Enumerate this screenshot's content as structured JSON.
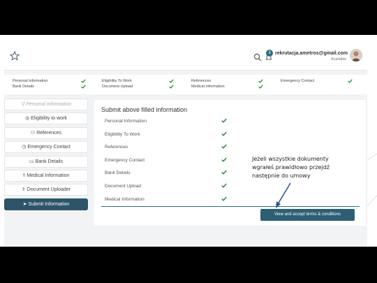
{
  "topbar": {
    "email": "rekrutacja.ametros@gmail.com",
    "status": "Available",
    "notification_count": "3"
  },
  "summary": [
    {
      "label": "Personal information",
      "done": true
    },
    {
      "label": "Bank Details",
      "done": true
    },
    {
      "label": "Eligibility To Work",
      "done": true
    },
    {
      "label": "Document Upload",
      "done": true
    },
    {
      "label": "References",
      "done": true
    },
    {
      "label": "Medical information",
      "done": true
    },
    {
      "label": "Emergency Contact",
      "done": true
    }
  ],
  "nav": [
    {
      "label": "Personal Information",
      "icon": "user-icon",
      "glyph": "⚲"
    },
    {
      "label": "Eligibility to work",
      "icon": "globe-icon",
      "glyph": "◎"
    },
    {
      "label": "References",
      "icon": "users-icon",
      "glyph": "⚇"
    },
    {
      "label": "Emergency Contact",
      "icon": "clock-icon",
      "glyph": "◷"
    },
    {
      "label": "Bank Details",
      "icon": "card-icon",
      "glyph": "▭"
    },
    {
      "label": "Medical Information",
      "icon": "medical-icon",
      "glyph": "⚕"
    },
    {
      "label": "Document Uploader",
      "icon": "upload-icon",
      "glyph": "⇪"
    },
    {
      "label": "Submit Information",
      "icon": "send-icon",
      "glyph": "➤"
    }
  ],
  "panel": {
    "title": "Submit above filled information",
    "rows": [
      {
        "label": "Personal Information",
        "done": true
      },
      {
        "label": "Eligibility To Work",
        "done": true
      },
      {
        "label": "References",
        "done": true
      },
      {
        "label": "Emergency Contact",
        "done": true
      },
      {
        "label": "Bank Details",
        "done": true
      },
      {
        "label": "Document Upload",
        "done": true
      },
      {
        "label": "Medical Information",
        "done": true
      }
    ],
    "submit_label": "View and accept terms & conditions"
  },
  "annotation": {
    "line1": "Jeżeli wszystkie dokumenty",
    "line2": "wgrałeś prawidłowo przejdź",
    "line3": "następnie do umowy"
  },
  "colors": {
    "accent": "#2d5f74",
    "check": "#2e8b3a"
  }
}
